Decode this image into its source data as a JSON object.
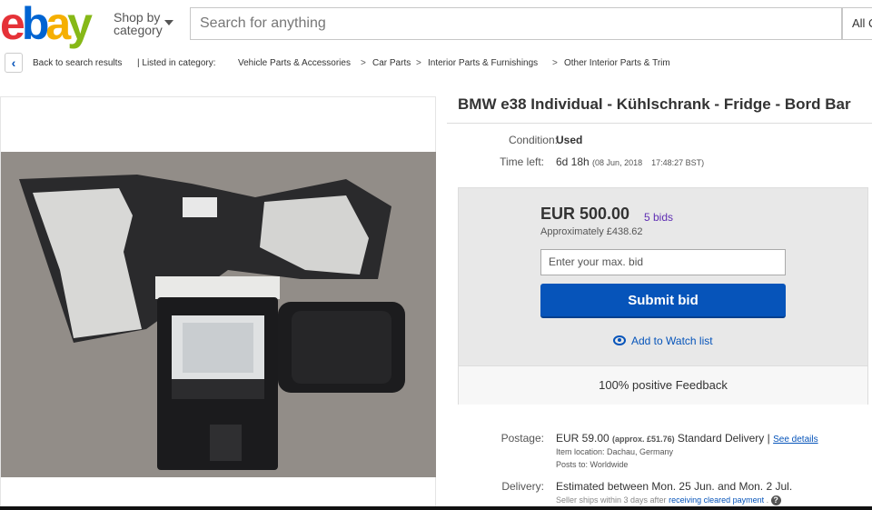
{
  "header": {
    "logo_letters": [
      "e",
      "b",
      "a",
      "y"
    ],
    "shop_by_line1": "Shop by",
    "shop_by_line2": "category",
    "search_placeholder": "Search for anything",
    "all_categories": "All C"
  },
  "breadcrumb": {
    "back_label": "Back to search results",
    "listed_in": "| Listed in category:",
    "items": [
      "Vehicle Parts & Accessories",
      "Car Parts",
      "Interior Parts & Furnishings",
      "Other Interior Parts & Trim"
    ],
    "separator": ">"
  },
  "listing": {
    "title": "BMW e38 Individual - Kühlschrank - Fridge - Bord Bar",
    "condition_label": "Condition:",
    "condition_value": "Used",
    "time_left_label": "Time left:",
    "time_left_value": "6d 18h",
    "time_left_date": "(08 Jun, 2018",
    "time_left_time": "17:48:27 BST)"
  },
  "bid": {
    "price": "EUR 500.00",
    "bids": "5 bids",
    "approx": "Approximately £438.62",
    "input_placeholder": "Enter your max. bid",
    "submit_label": "Submit bid",
    "watch_label": "Add to Watch list",
    "feedback": "100% positive Feedback"
  },
  "shipping": {
    "postage_label": "Postage:",
    "postage_value": "EUR 59.00",
    "postage_approx": "(approx. £51.76)",
    "postage_method": "Standard Delivery |",
    "see_details": "See details",
    "item_location": "Item location:  Dachau, Germany",
    "posts_to": "Posts to:  Worldwide",
    "delivery_label": "Delivery:",
    "delivery_value": "Estimated between Mon. 25 Jun. and Mon. 2 Jul.",
    "seller_ships": "Seller ships within 3 days after",
    "cleared_payment": "receiving cleared payment",
    "help_icon": "?"
  },
  "colors": {
    "link": "#0654ba",
    "submit": "#0654ba",
    "bids": "#5f2eb3"
  }
}
